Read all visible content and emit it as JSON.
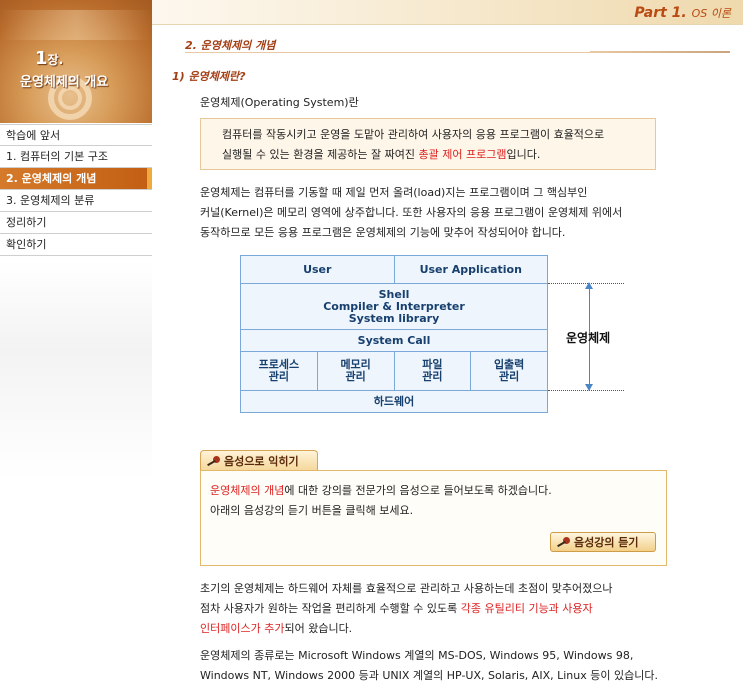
{
  "header": {
    "part_label": "Part 1.",
    "part_subtitle": "OS 이론"
  },
  "chapter": {
    "number": "1",
    "suffix": "장.",
    "name": "운영체제의 개요"
  },
  "sidebar": {
    "items": [
      {
        "label": "학습에 앞서",
        "active": false
      },
      {
        "label": "1. 컴퓨터의 기본 구조",
        "active": false
      },
      {
        "label": "2. 운영체제의 개념",
        "active": true
      },
      {
        "label": "3. 운영체제의 분류",
        "active": false
      },
      {
        "label": "정리하기",
        "active": false
      },
      {
        "label": "확인하기",
        "active": false
      }
    ]
  },
  "content": {
    "section_title": "2. 운영체제의 개념",
    "subsection_title": "1) 운영체제란?",
    "term": "운영체제(Operating System)란",
    "definition": {
      "line1": "컴퓨터를 작동시키고 운영을 도맡아 관리하여 사용자의 응용 프로그램이 효율적으로",
      "line2_pre": "실행될 수 있는 환경을 제공하는 잘 짜여진 ",
      "line2_highlight": "총괄 제어 프로그램",
      "line2_post": "입니다."
    },
    "paragraph1": [
      "운영체제는 컴퓨터를 기동할 때 제일 먼저 올려(load)지는 프로그램이며 그 핵심부인",
      "커널(Kernel)은 메모리 영역에 상주합니다. 또한 사용자의 응용 프로그램이 운영체제 위에서",
      "동작하므로 모든 응용 프로그램은 운영체제의 기능에 맞추어 작성되어야 합니다."
    ],
    "diagram": {
      "row1": [
        "User",
        "User Application"
      ],
      "row2": [
        "Shell",
        "Compiler & Interpreter",
        "System library"
      ],
      "row3": "System Call",
      "row4": [
        {
          "line1": "프로세스",
          "line2": "관리"
        },
        {
          "line1": "메모리",
          "line2": "관리"
        },
        {
          "line1": "파일",
          "line2": "관리"
        },
        {
          "line1": "입출력",
          "line2": "관리"
        }
      ],
      "row5": "하드웨어",
      "side_label": "운영체제"
    },
    "audio": {
      "tab_label": "음성으로 익히기",
      "line1_highlight": "운영체제의 개념",
      "line1_post": "에 대한 강의를 전문가의 음성으로 들어보도록 하겠습니다.",
      "line2": "아래의 음성강의 듣기 버튼을 클릭해 보세요.",
      "button_label": "음성강의 듣기"
    },
    "paragraph2": {
      "line1": "초기의 운영체제는 하드웨어 자체를 효율적으로 관리하고 사용하는데 초점이 맞추어졌으나",
      "line2_pre": "점차 사용자가 원하는 작업을 편리하게 수행할 수 있도록 ",
      "line2_highlight": "각종 유틸리티 기능과 사용자",
      "line3_highlight": "인터페이스가 추가",
      "line3_post": "되어 왔습니다."
    },
    "paragraph3": [
      "운영체제의 종류로는 Microsoft Windows 계열의 MS-DOS, Windows 95, Windows 98,",
      "Windows NT, Windows 2000 등과 UNIX 계열의 HP-UX, Solaris, AIX, Linux 등이 있습니다."
    ]
  }
}
